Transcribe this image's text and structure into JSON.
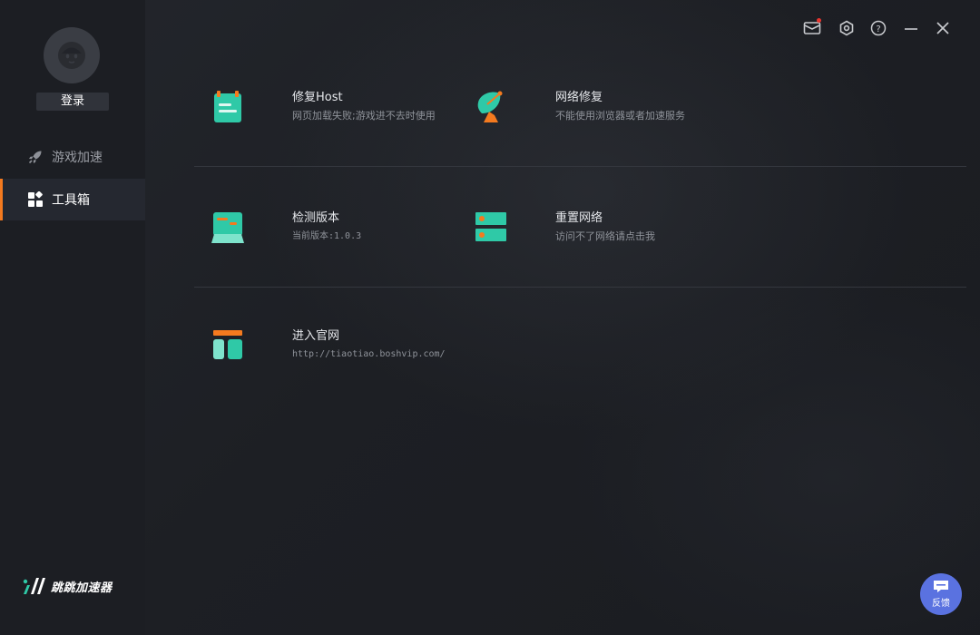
{
  "sidebar": {
    "login_label": "登录",
    "items": [
      {
        "label": "游戏加速",
        "icon": "rocket-icon",
        "active": false
      },
      {
        "label": "工具箱",
        "icon": "grid-icon",
        "active": true
      }
    ],
    "brand_name": "跳跳加速器"
  },
  "toolbox": {
    "items": [
      {
        "title": "修复Host",
        "desc": "网页加载失败;游戏进不去时使用",
        "icon": "notepad-icon"
      },
      {
        "title": "网络修复",
        "desc": "不能使用浏览器或者加速服务",
        "icon": "satellite-dish-icon"
      },
      {
        "title": "检测版本",
        "desc": "当前版本:1.0.3",
        "icon": "laptop-icon"
      },
      {
        "title": "重置网络",
        "desc": "访问不了网络请点击我",
        "icon": "server-icon"
      },
      {
        "title": "进入官网",
        "desc": "http://tiaotiao.boshvip.com/",
        "icon": "website-layout-icon"
      }
    ]
  },
  "feedback_label": "反馈",
  "colors": {
    "accent_orange": "#f47a1f",
    "accent_teal": "#2fc9a7",
    "feedback_blue": "#5a72e0",
    "notification_red": "#e8352f"
  }
}
